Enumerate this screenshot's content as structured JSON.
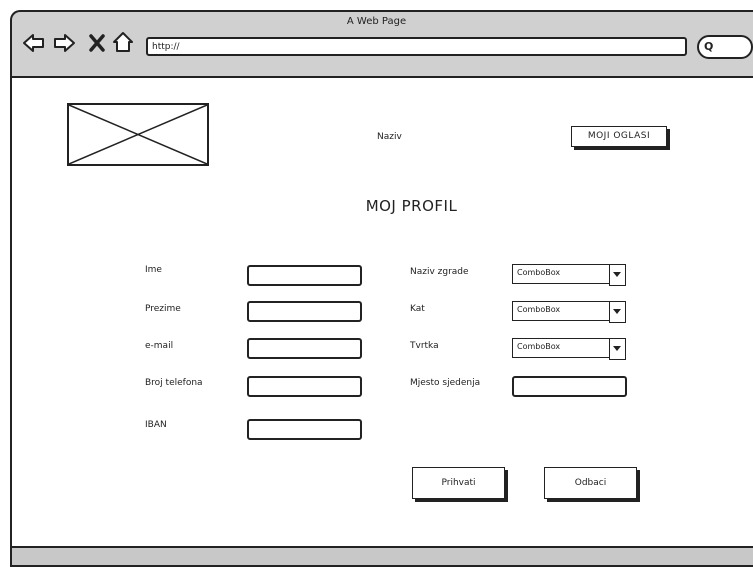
{
  "browser": {
    "title": "A Web Page",
    "url": "http://",
    "search_glyph": "Q"
  },
  "icons": {
    "back": "back-arrow-icon",
    "forward": "forward-arrow-icon",
    "stop": "close-icon",
    "home": "home-icon",
    "search": "search-icon"
  },
  "header": {
    "app_name": "Naziv",
    "my_ads_label": "MOJI OGLASI"
  },
  "page_title": "MOJ PROFIL",
  "form": {
    "left_fields": [
      {
        "label": "Ime",
        "value": ""
      },
      {
        "label": "Prezime",
        "value": ""
      },
      {
        "label": "e-mail",
        "value": ""
      },
      {
        "label": "Broj telefona",
        "value": ""
      },
      {
        "label": "IBAN",
        "value": ""
      }
    ],
    "right_fields": [
      {
        "label": "Naziv zgrade",
        "type": "combo",
        "value": "ComboBox"
      },
      {
        "label": "Kat",
        "type": "combo",
        "value": "ComboBox"
      },
      {
        "label": "Tvrtka",
        "type": "combo",
        "value": "ComboBox"
      },
      {
        "label": "Mjesto sjedenja",
        "type": "text",
        "value": ""
      }
    ]
  },
  "actions": {
    "accept_label": "Prihvati",
    "reject_label": "Odbaci"
  }
}
